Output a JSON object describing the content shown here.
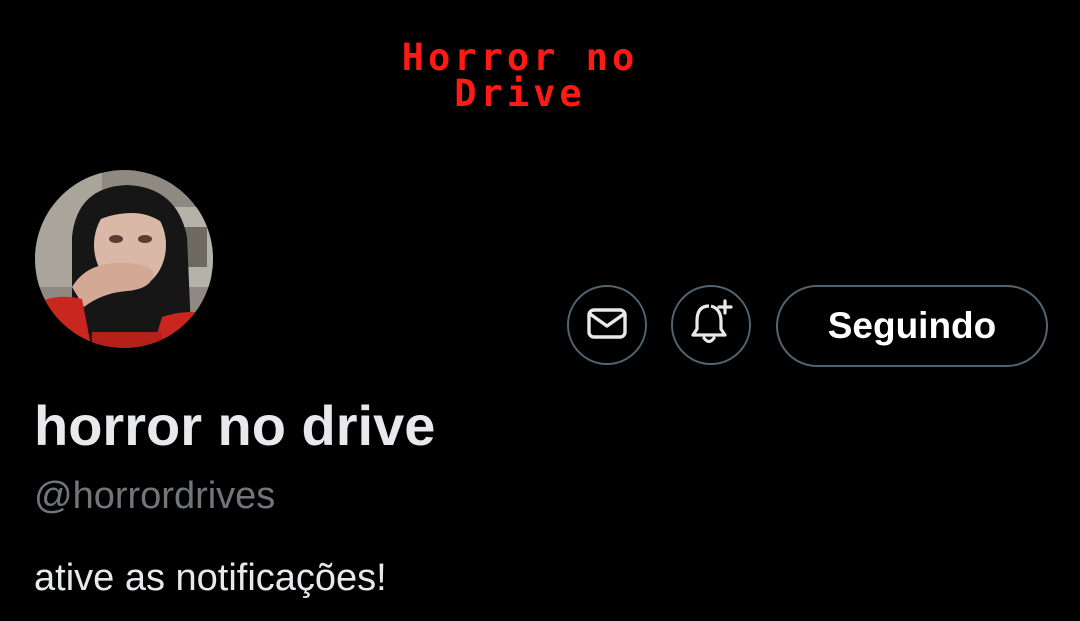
{
  "banner": {
    "line1": "Horror no",
    "line2": "Drive",
    "text_color": "#ff1a14"
  },
  "profile": {
    "avatar_icon": "profile-photo",
    "display_name": "horror no drive",
    "handle": "@horrordrives",
    "bio": "ative as notificações!"
  },
  "actions": {
    "message_icon": "envelope-icon",
    "notify_icon": "bell-plus-icon",
    "follow_label": "Seguindo"
  },
  "colors": {
    "background": "#000000",
    "text_primary": "#e7e9ea",
    "text_secondary": "#71767b",
    "button_border": "#536471"
  }
}
